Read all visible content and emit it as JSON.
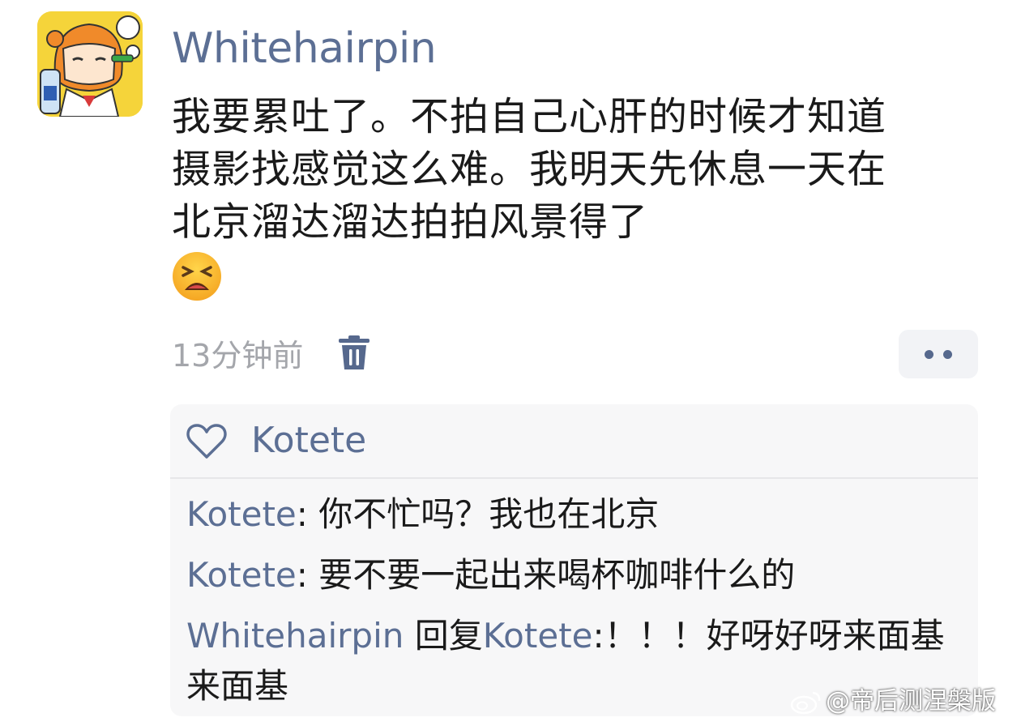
{
  "post": {
    "author": "Whitehairpin",
    "text": "我要累吐了。不拍自己心肝的时候才知道摄影找感觉这么难。我明天先休息一天在北京溜达溜达拍拍风景得了",
    "emoji_icon": "tired-face-emoji",
    "time": "13分钟前",
    "avatar_icon": "cartoon-girl-avatar"
  },
  "actions": {
    "delete_icon": "trash-icon",
    "more_icon": "more-dots-icon"
  },
  "comments": {
    "likes": {
      "icon": "heart-outline-icon",
      "names": "Kotete"
    },
    "replies": [
      {
        "name": "Kotete",
        "sep": ": ",
        "text": "你不忙吗？我也在北京"
      },
      {
        "name": "Kotete",
        "sep": ": ",
        "text": "要不要一起出来喝杯咖啡什么的"
      },
      {
        "name": "Whitehairpin",
        "mid": " 回复",
        "target": "Kotete",
        "sep": ":",
        "text": "！！！好呀好呀来面基来面基"
      }
    ]
  },
  "watermark": {
    "text": "@帝后测涅槃版",
    "icon": "weibo-logo"
  },
  "colors": {
    "link": "#5c6f94",
    "time": "#a4a6ab",
    "panel": "#f7f7f8"
  }
}
